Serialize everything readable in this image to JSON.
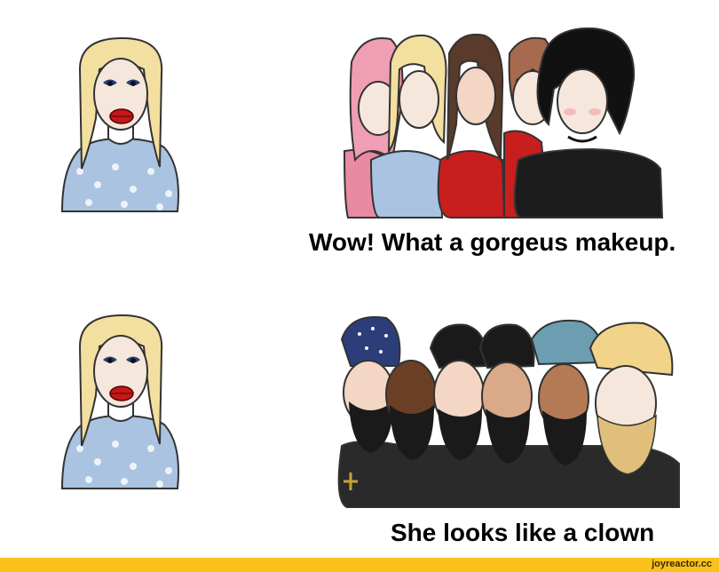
{
  "captions": {
    "top": "Wow! What a gorgeus makeup.",
    "bottom": "She looks like a clown"
  },
  "watermark": "joyreactor.cc",
  "colors": {
    "background": "#ffffff",
    "footer": "#f8c21a",
    "hair_blonde": "#f3dfa0",
    "dress_blue": "#a9c3e0",
    "lips": "#c41818"
  }
}
